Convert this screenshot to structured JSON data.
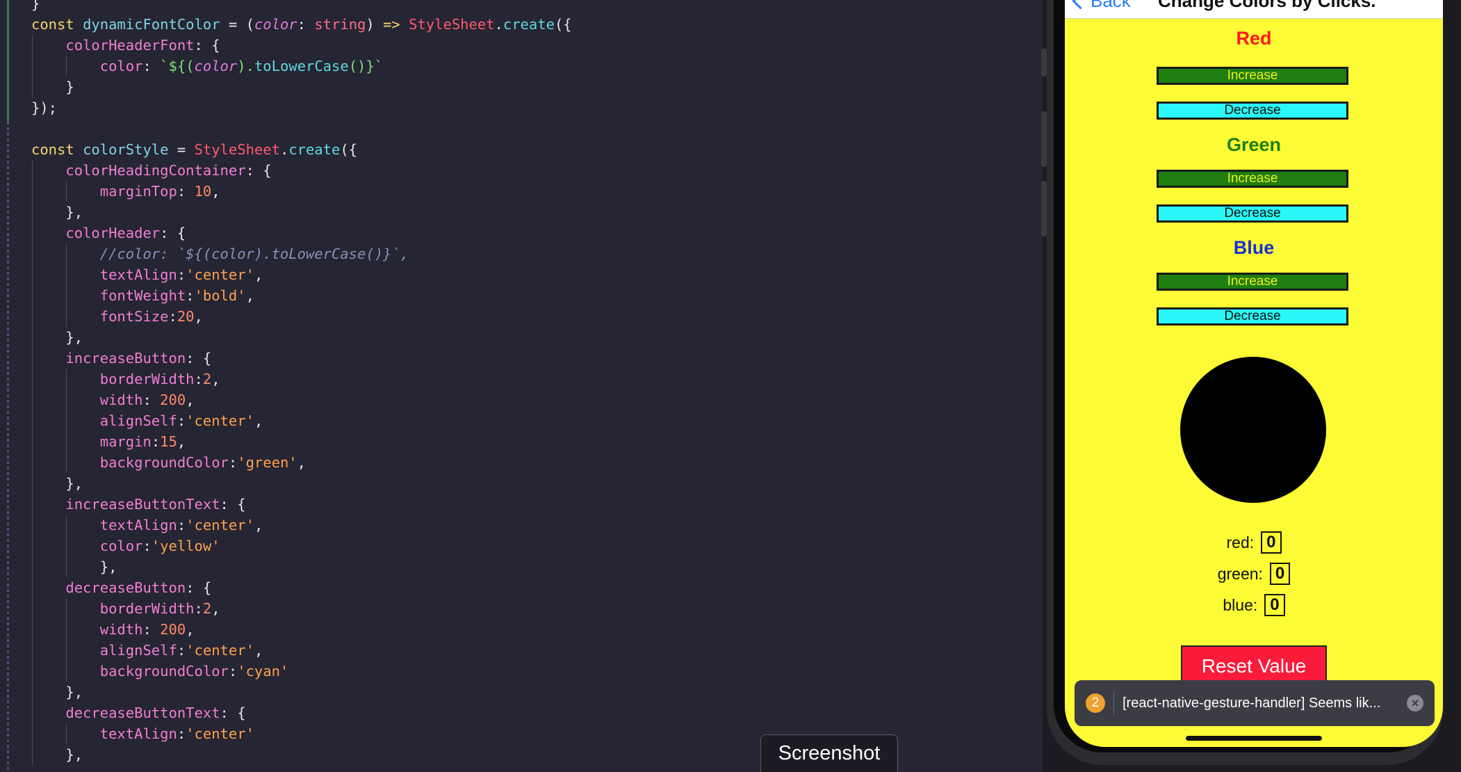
{
  "editor": {
    "lines": [
      [
        {
          "t": "}",
          "c": "pun"
        }
      ],
      [
        {
          "t": "const ",
          "c": "kw"
        },
        {
          "t": "dynamicFontColor",
          "c": "id"
        },
        {
          "t": " = (",
          "c": "pun"
        },
        {
          "t": "color",
          "c": "par"
        },
        {
          "t": ": ",
          "c": "pun"
        },
        {
          "t": "string",
          "c": "ty"
        },
        {
          "t": ") ",
          "c": "pun"
        },
        {
          "t": "=>",
          "c": "kw"
        },
        {
          "t": " ",
          "c": "pun"
        },
        {
          "t": "StyleSheet",
          "c": "cls"
        },
        {
          "t": ".",
          "c": "pun"
        },
        {
          "t": "create",
          "c": "fn"
        },
        {
          "t": "({",
          "c": "pun"
        }
      ],
      [
        {
          "t": "    ",
          "c": "pun"
        },
        {
          "t": "colorHeaderFont",
          "c": "prop"
        },
        {
          "t": ": {",
          "c": "pun"
        }
      ],
      [
        {
          "t": "        ",
          "c": "pun"
        },
        {
          "t": "color",
          "c": "prop"
        },
        {
          "t": ": ",
          "c": "pun"
        },
        {
          "t": "`${(",
          "c": "tpl"
        },
        {
          "t": "color",
          "c": "par"
        },
        {
          "t": ").",
          "c": "tpl"
        },
        {
          "t": "toLowerCase",
          "c": "fn"
        },
        {
          "t": "()}`",
          "c": "tpl"
        }
      ],
      [
        {
          "t": "    }",
          "c": "pun"
        }
      ],
      [
        {
          "t": "});",
          "c": "pun"
        }
      ],
      [
        {
          "t": "",
          "c": "pun"
        }
      ],
      [
        {
          "t": "const ",
          "c": "kw"
        },
        {
          "t": "colorStyle",
          "c": "id"
        },
        {
          "t": " = ",
          "c": "pun"
        },
        {
          "t": "StyleSheet",
          "c": "cls"
        },
        {
          "t": ".",
          "c": "pun"
        },
        {
          "t": "create",
          "c": "fn"
        },
        {
          "t": "({",
          "c": "pun"
        }
      ],
      [
        {
          "t": "    ",
          "c": "pun"
        },
        {
          "t": "colorHeadingContainer",
          "c": "prop"
        },
        {
          "t": ": {",
          "c": "pun"
        }
      ],
      [
        {
          "t": "        ",
          "c": "pun"
        },
        {
          "t": "marginTop",
          "c": "prop"
        },
        {
          "t": ": ",
          "c": "pun"
        },
        {
          "t": "10",
          "c": "num"
        },
        {
          "t": ",",
          "c": "pun"
        }
      ],
      [
        {
          "t": "    },",
          "c": "pun"
        }
      ],
      [
        {
          "t": "    ",
          "c": "pun"
        },
        {
          "t": "colorHeader",
          "c": "prop"
        },
        {
          "t": ": {",
          "c": "pun"
        }
      ],
      [
        {
          "t": "        ",
          "c": "pun"
        },
        {
          "t": "//color: `${(color).toLowerCase()}`,",
          "c": "com"
        }
      ],
      [
        {
          "t": "        ",
          "c": "pun"
        },
        {
          "t": "textAlign",
          "c": "prop"
        },
        {
          "t": ":",
          "c": "pun"
        },
        {
          "t": "'center'",
          "c": "str"
        },
        {
          "t": ",",
          "c": "pun"
        }
      ],
      [
        {
          "t": "        ",
          "c": "pun"
        },
        {
          "t": "fontWeight",
          "c": "prop"
        },
        {
          "t": ":",
          "c": "pun"
        },
        {
          "t": "'bold'",
          "c": "str"
        },
        {
          "t": ",",
          "c": "pun"
        }
      ],
      [
        {
          "t": "        ",
          "c": "pun"
        },
        {
          "t": "fontSize",
          "c": "prop"
        },
        {
          "t": ":",
          "c": "pun"
        },
        {
          "t": "20",
          "c": "num"
        },
        {
          "t": ",",
          "c": "pun"
        }
      ],
      [
        {
          "t": "    },",
          "c": "pun"
        }
      ],
      [
        {
          "t": "    ",
          "c": "pun"
        },
        {
          "t": "increaseButton",
          "c": "prop"
        },
        {
          "t": ": {",
          "c": "pun"
        }
      ],
      [
        {
          "t": "        ",
          "c": "pun"
        },
        {
          "t": "borderWidth",
          "c": "prop"
        },
        {
          "t": ":",
          "c": "pun"
        },
        {
          "t": "2",
          "c": "num"
        },
        {
          "t": ",",
          "c": "pun"
        }
      ],
      [
        {
          "t": "        ",
          "c": "pun"
        },
        {
          "t": "width",
          "c": "prop"
        },
        {
          "t": ": ",
          "c": "pun"
        },
        {
          "t": "200",
          "c": "num"
        },
        {
          "t": ",",
          "c": "pun"
        }
      ],
      [
        {
          "t": "        ",
          "c": "pun"
        },
        {
          "t": "alignSelf",
          "c": "prop"
        },
        {
          "t": ":",
          "c": "pun"
        },
        {
          "t": "'center'",
          "c": "str"
        },
        {
          "t": ",",
          "c": "pun"
        }
      ],
      [
        {
          "t": "        ",
          "c": "pun"
        },
        {
          "t": "margin",
          "c": "prop"
        },
        {
          "t": ":",
          "c": "pun"
        },
        {
          "t": "15",
          "c": "num"
        },
        {
          "t": ",",
          "c": "pun"
        }
      ],
      [
        {
          "t": "        ",
          "c": "pun"
        },
        {
          "t": "backgroundColor",
          "c": "prop"
        },
        {
          "t": ":",
          "c": "pun"
        },
        {
          "t": "'green'",
          "c": "str"
        },
        {
          "t": ",",
          "c": "pun"
        }
      ],
      [
        {
          "t": "    },",
          "c": "pun"
        }
      ],
      [
        {
          "t": "    ",
          "c": "pun"
        },
        {
          "t": "increaseButtonText",
          "c": "prop"
        },
        {
          "t": ": {",
          "c": "pun"
        }
      ],
      [
        {
          "t": "        ",
          "c": "pun"
        },
        {
          "t": "textAlign",
          "c": "prop"
        },
        {
          "t": ":",
          "c": "pun"
        },
        {
          "t": "'center'",
          "c": "str"
        },
        {
          "t": ",",
          "c": "pun"
        }
      ],
      [
        {
          "t": "        ",
          "c": "pun"
        },
        {
          "t": "color",
          "c": "prop"
        },
        {
          "t": ":",
          "c": "pun"
        },
        {
          "t": "'yellow'",
          "c": "str"
        }
      ],
      [
        {
          "t": "        },",
          "c": "pun"
        }
      ],
      [
        {
          "t": "    ",
          "c": "pun"
        },
        {
          "t": "decreaseButton",
          "c": "prop"
        },
        {
          "t": ": {",
          "c": "pun"
        }
      ],
      [
        {
          "t": "        ",
          "c": "pun"
        },
        {
          "t": "borderWidth",
          "c": "prop"
        },
        {
          "t": ":",
          "c": "pun"
        },
        {
          "t": "2",
          "c": "num"
        },
        {
          "t": ",",
          "c": "pun"
        }
      ],
      [
        {
          "t": "        ",
          "c": "pun"
        },
        {
          "t": "width",
          "c": "prop"
        },
        {
          "t": ": ",
          "c": "pun"
        },
        {
          "t": "200",
          "c": "num"
        },
        {
          "t": ",",
          "c": "pun"
        }
      ],
      [
        {
          "t": "        ",
          "c": "pun"
        },
        {
          "t": "alignSelf",
          "c": "prop"
        },
        {
          "t": ":",
          "c": "pun"
        },
        {
          "t": "'center'",
          "c": "str"
        },
        {
          "t": ",",
          "c": "pun"
        }
      ],
      [
        {
          "t": "        ",
          "c": "pun"
        },
        {
          "t": "backgroundColor",
          "c": "prop"
        },
        {
          "t": ":",
          "c": "pun"
        },
        {
          "t": "'cyan'",
          "c": "str"
        }
      ],
      [
        {
          "t": "    },",
          "c": "pun"
        }
      ],
      [
        {
          "t": "    ",
          "c": "pun"
        },
        {
          "t": "decreaseButtonText",
          "c": "prop"
        },
        {
          "t": ": {",
          "c": "pun"
        }
      ],
      [
        {
          "t": "        ",
          "c": "pun"
        },
        {
          "t": "textAlign",
          "c": "prop"
        },
        {
          "t": ":",
          "c": "pun"
        },
        {
          "t": "'center'",
          "c": "str"
        }
      ],
      [
        {
          "t": "    },",
          "c": "pun"
        }
      ]
    ]
  },
  "tooltip": {
    "label": "Screenshot"
  },
  "app": {
    "nav": {
      "back_label": "Back",
      "title": "Change Colors by Clicks."
    },
    "sections": [
      {
        "heading": "Red",
        "heading_color": "#ff1a1a",
        "increase_label": "Increase",
        "decrease_label": "Decrease"
      },
      {
        "heading": "Green",
        "heading_color": "#1e7e10",
        "increase_label": "Increase",
        "decrease_label": "Decrease"
      },
      {
        "heading": "Blue",
        "heading_color": "#1a2fd0",
        "increase_label": "Increase",
        "decrease_label": "Decrease"
      }
    ],
    "preview_color": "#000000",
    "values": [
      {
        "label": "red:",
        "value": "0"
      },
      {
        "label": "green:",
        "value": "0"
      },
      {
        "label": "blue:",
        "value": "0"
      }
    ],
    "reset_label": "Reset Value",
    "toast": {
      "count": "2",
      "message": "[react-native-gesture-handler] Seems lik...",
      "close_icon": "×"
    }
  }
}
